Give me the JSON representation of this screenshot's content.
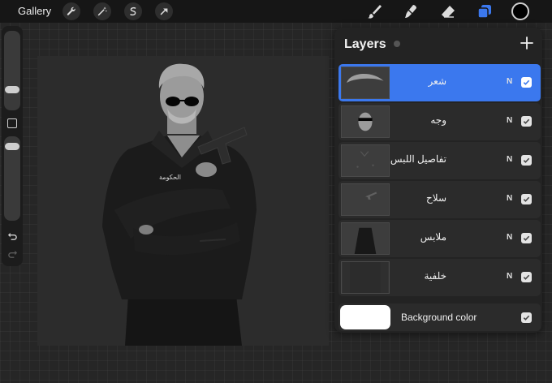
{
  "toolbar": {
    "gallery_label": "Gallery",
    "action_icons": [
      "wrench-icon",
      "magic-wand-icon",
      "selection-icon",
      "transform-arrow-icon"
    ],
    "tool_icons": [
      "brush-icon",
      "smudge-icon",
      "eraser-icon",
      "layers-icon"
    ],
    "active_tool": "layers",
    "current_color": "#000000",
    "accent_color": "#3b78ee"
  },
  "layers_panel": {
    "title": "Layers",
    "add_icon": "plus-icon",
    "layers": [
      {
        "name": "شعر",
        "blend": "N",
        "visible": true,
        "selected": true
      },
      {
        "name": "وجه",
        "blend": "N",
        "visible": true,
        "selected": false
      },
      {
        "name": "تفاصيل اللبس",
        "blend": "N",
        "visible": true,
        "selected": false
      },
      {
        "name": "سلاح",
        "blend": "N",
        "visible": true,
        "selected": false
      },
      {
        "name": "ملابس",
        "blend": "N",
        "visible": true,
        "selected": false
      },
      {
        "name": "خلفية",
        "blend": "N",
        "visible": true,
        "selected": false
      }
    ],
    "background": {
      "label": "Background color",
      "color": "#ffffff",
      "visible": true
    }
  },
  "canvas": {
    "background_color": "#2c2c2c",
    "jacket_text": "الحكومة"
  }
}
